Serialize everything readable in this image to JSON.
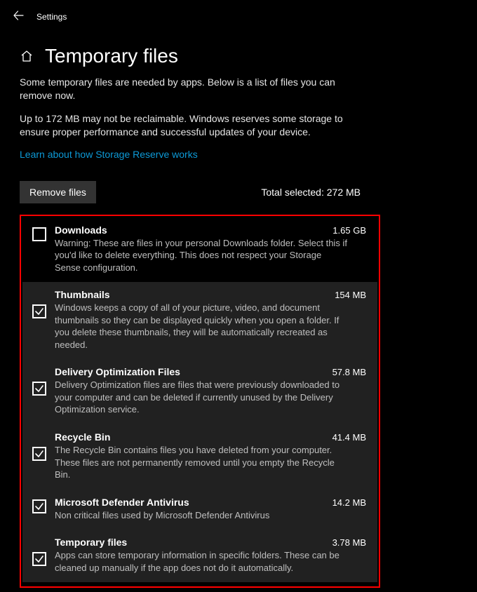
{
  "titlebar": {
    "label": "Settings"
  },
  "page": {
    "title": "Temporary files",
    "intro1": "Some temporary files are needed by apps. Below is a list of files you can remove now.",
    "intro2": "Up to 172 MB may not be reclaimable. Windows reserves some storage to ensure proper performance and successful updates of your device.",
    "link": "Learn about how Storage Reserve works",
    "remove_button": "Remove files",
    "total_selected": "Total selected: 272 MB"
  },
  "items": [
    {
      "title": "Downloads",
      "size": "1.65 GB",
      "desc": "Warning: These are files in your personal Downloads folder. Select this if you'd like to delete everything. This does not respect your Storage Sense configuration.",
      "checked": false
    },
    {
      "title": "Thumbnails",
      "size": "154 MB",
      "desc": "Windows keeps a copy of all of your picture, video, and document thumbnails so they can be displayed quickly when you open a folder. If you delete these thumbnails, they will be automatically recreated as needed.",
      "checked": true
    },
    {
      "title": "Delivery Optimization Files",
      "size": "57.8 MB",
      "desc": "Delivery Optimization files are files that were previously downloaded to your computer and can be deleted if currently unused by the Delivery Optimization service.",
      "checked": true
    },
    {
      "title": "Recycle Bin",
      "size": "41.4 MB",
      "desc": "The Recycle Bin contains files you have deleted from your computer. These files are not permanently removed until you empty the Recycle Bin.",
      "checked": true
    },
    {
      "title": "Microsoft Defender Antivirus",
      "size": "14.2 MB",
      "desc": "Non critical files used by Microsoft Defender Antivirus",
      "checked": true
    },
    {
      "title": "Temporary files",
      "size": "3.78 MB",
      "desc": "Apps can store temporary information in specific folders. These can be cleaned up manually if the app does not do it automatically.",
      "checked": true
    }
  ]
}
